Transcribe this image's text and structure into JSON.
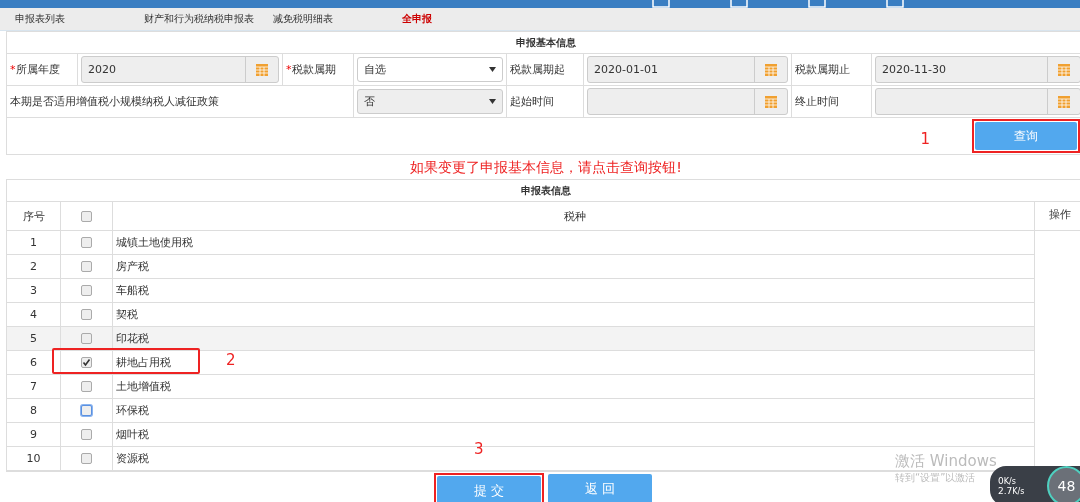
{
  "tabs": [
    {
      "label": "申报表列表",
      "selected": false
    },
    {
      "label": "财产和行为税纳税申报表",
      "selected": false
    },
    {
      "label": "减免税明细表",
      "selected": false
    },
    {
      "label": "全申报",
      "selected": true
    }
  ],
  "basic_info": {
    "title": "申报基本信息",
    "fields": [
      {
        "marker": "*",
        "label": "所属年度",
        "kind": "date",
        "value": "2020"
      },
      {
        "marker": "*",
        "label": "税款属期",
        "kind": "select",
        "value": "自选",
        "disabled": false
      },
      {
        "label": "税款属期起",
        "kind": "date",
        "value": "2020-01-01"
      },
      {
        "label": "税款属期止",
        "kind": "date",
        "value": "2020-11-30"
      },
      {
        "label": "本期是否适用增值税小规模纳税人减征政策",
        "kind": "wide_select",
        "value": "否",
        "disabled": true
      },
      {
        "label": "起始时间",
        "kind": "date"
      },
      {
        "label": "终止时间",
        "kind": "date"
      }
    ],
    "query_button": "查询",
    "callout": "1"
  },
  "notice": "如果变更了申报基本信息，请点击查询按钮!",
  "table": {
    "title": "申报表信息",
    "columns": [
      "序号",
      "税种",
      "操作"
    ],
    "header_checked": false,
    "rows": [
      {
        "no": "1",
        "name": "城镇土地使用税",
        "checked": false,
        "hovered": false,
        "focused": false
      },
      {
        "no": "2",
        "name": "房产税",
        "checked": false,
        "hovered": false,
        "focused": false
      },
      {
        "no": "3",
        "name": "车船税",
        "checked": false,
        "hovered": false,
        "focused": false
      },
      {
        "no": "4",
        "name": "契税",
        "checked": false,
        "hovered": false,
        "focused": false
      },
      {
        "no": "5",
        "name": "印花税",
        "checked": false,
        "hovered": true,
        "focused": false
      },
      {
        "no": "6",
        "name": "耕地占用税",
        "checked": true,
        "hovered": false,
        "focused": false,
        "callout": "2"
      },
      {
        "no": "7",
        "name": "土地增值税",
        "checked": false,
        "hovered": false,
        "focused": false
      },
      {
        "no": "8",
        "name": "环保税",
        "checked": false,
        "hovered": false,
        "focused": true
      },
      {
        "no": "9",
        "name": "烟叶税",
        "checked": false,
        "hovered": false,
        "focused": false
      },
      {
        "no": "10",
        "name": "资源税",
        "checked": false,
        "hovered": false,
        "focused": false
      }
    ]
  },
  "actions": {
    "submit": "提 交",
    "back": "返 回",
    "callout": "3"
  },
  "activation": {
    "title": "激活 Windows",
    "subtitle": "转到“设置”以激活"
  },
  "net_widget": {
    "up": "0",
    "up_unit": "K/s",
    "down": "2.7",
    "down_unit": "K/s",
    "percent": "48"
  }
}
